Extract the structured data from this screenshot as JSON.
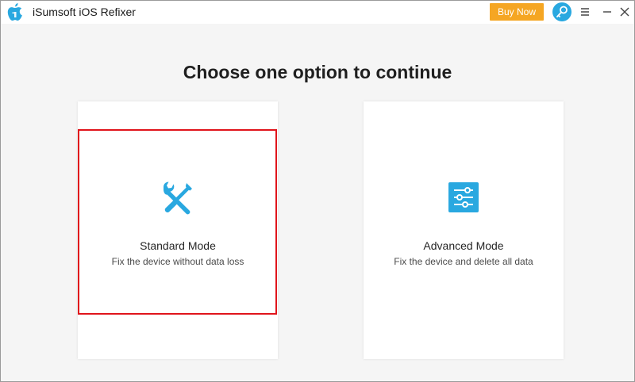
{
  "window": {
    "title": "iSumsoft iOS Refixer"
  },
  "toolbar": {
    "buy_label": "Buy Now",
    "key_icon": "key-icon",
    "menu_icon": "hamburger-menu-icon",
    "minimize_icon": "minimize-icon",
    "close_icon": "close-icon"
  },
  "main": {
    "heading": "Choose one option to continue",
    "options": [
      {
        "title": "Standard Mode",
        "description": "Fix the device without data loss",
        "icon": "wrench-screwdriver-icon",
        "selected": true
      },
      {
        "title": "Advanced Mode",
        "description": "Fix the device and delete all data",
        "icon": "sliders-icon",
        "selected": false
      }
    ]
  },
  "colors": {
    "accent": "#29a8e0",
    "buy_button": "#f5a623",
    "selection": "#e0141b",
    "background": "#f5f5f5"
  }
}
